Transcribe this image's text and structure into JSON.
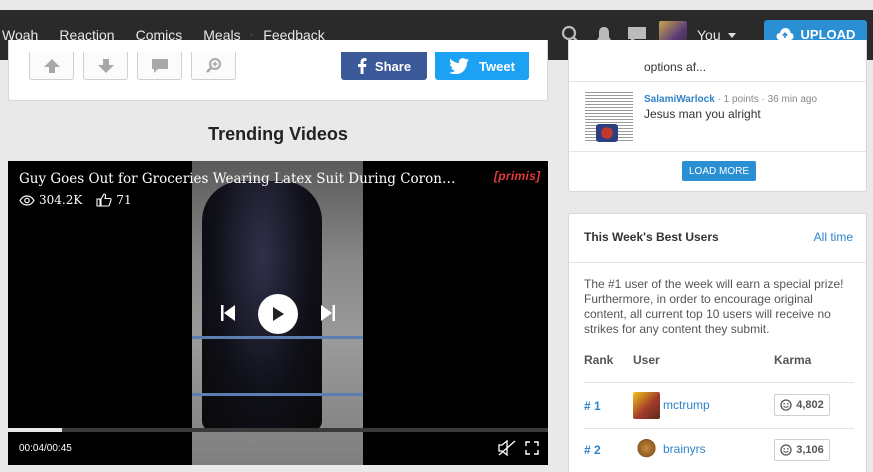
{
  "nav": {
    "links": [
      "Woah",
      "Reaction",
      "Comics",
      "Meals",
      "Feedback"
    ],
    "user_label": "You",
    "upload_label": "UPLOAD"
  },
  "post_actions": {
    "share_label": "Share",
    "tweet_label": "Tweet"
  },
  "trending": {
    "heading": "Trending Videos",
    "video": {
      "title": "Guy Goes Out for Groceries Wearing Latex Suit During Coronavirus Pand…",
      "views": "304.2K",
      "likes": "71",
      "brand": "[primis]",
      "time": "00:04/00:45",
      "progress_fraction": 0.1
    }
  },
  "comments": {
    "prev_text": "options af...",
    "latest": {
      "user": "SalamiWarlock",
      "meta": "· 1 points · 36 min ago",
      "text": "Jesus man you alright"
    },
    "load_more_label": "LOAD MORE"
  },
  "best_users": {
    "title": "This Week's Best Users",
    "all_time_label": "All time",
    "description": "The #1 user of the week will earn a special prize! Furthermore, in order to encourage original content, all current top 10 users will receive no strikes for any content they submit.",
    "columns": [
      "Rank",
      "User",
      "Karma"
    ],
    "rows": [
      {
        "rank": "# 1",
        "user": "mctrump",
        "karma": "4,802"
      },
      {
        "rank": "# 2",
        "user": "brainyrs",
        "karma": "3,106"
      }
    ]
  },
  "colors": {
    "nav_bg": "#2a2a2a",
    "accent": "#2b8fd4",
    "facebook": "#3b5998",
    "twitter": "#1da1f2",
    "link": "#2f83c8"
  }
}
